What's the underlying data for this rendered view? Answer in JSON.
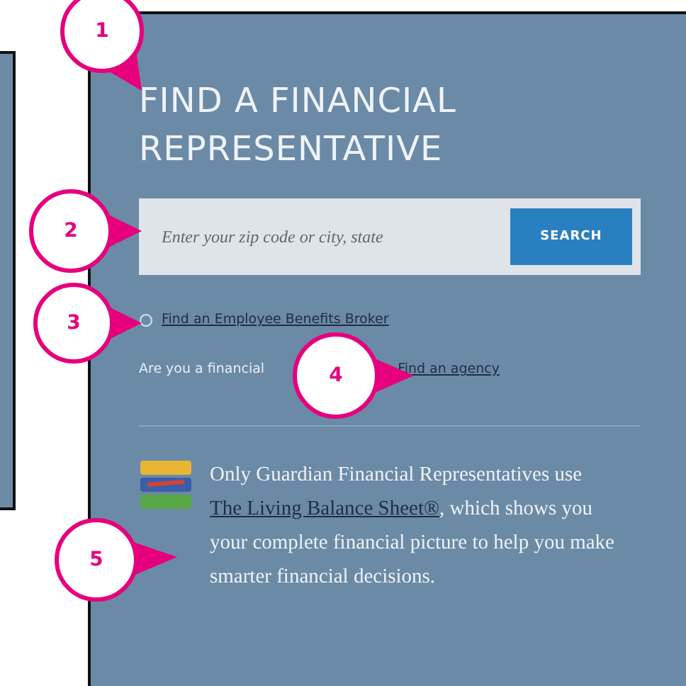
{
  "panel": {
    "title": "FIND A FINANCIAL REPRESENTATIVE",
    "search": {
      "placeholder": "Enter your zip code or city, state",
      "button": "SEARCH"
    },
    "broker_link": "Find an Employee Benefits Broker",
    "agency_row": {
      "text": "Are you a financial",
      "link": "Find an agency"
    },
    "promo": {
      "before": "Only Guardian Financial Representatives use ",
      "link": "The Living Balance Sheet®",
      "after": ", which shows you your complete financial picture to help you make smarter financial decisions."
    }
  },
  "callouts": [
    "1",
    "2",
    "3",
    "4",
    "5"
  ]
}
